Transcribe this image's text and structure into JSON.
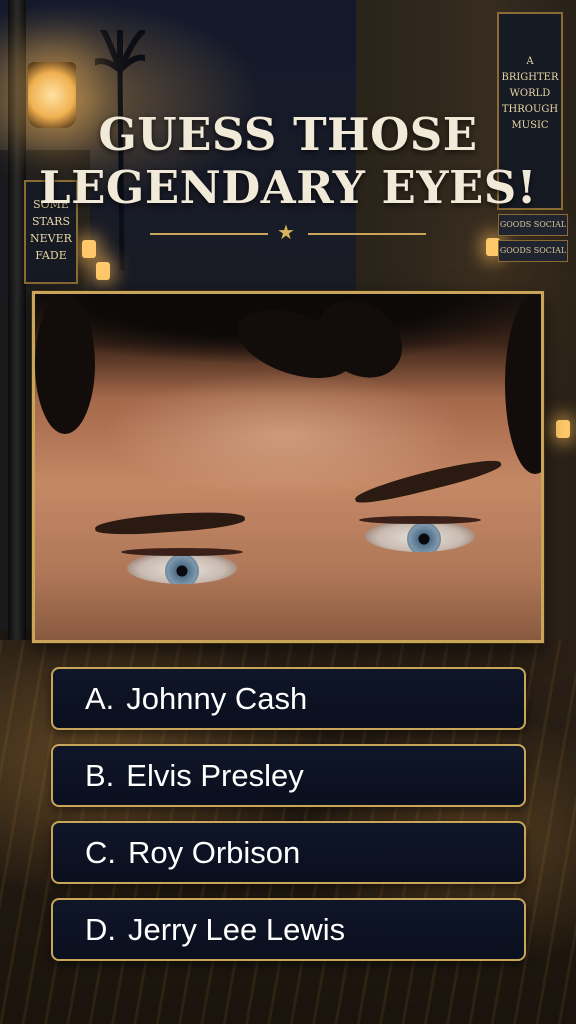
{
  "title": {
    "line1": "GUESS THOSE",
    "line2": "LEGENDARY EYES!"
  },
  "background_signs": {
    "left": [
      "SOME",
      "STARS",
      "NEVER",
      "FADE"
    ],
    "right": [
      "A",
      "BRIGHTER",
      "WORLD",
      "THROUGH",
      "MUSIC"
    ],
    "store_1": "GOODS SOCIAL",
    "store_2": "GOODS SOCIAL"
  },
  "image": {
    "alt": "eyes-closeup"
  },
  "options": [
    {
      "letter": "A.",
      "label": "Johnny Cash"
    },
    {
      "letter": "B.",
      "label": "Elvis Presley"
    },
    {
      "letter": "C.",
      "label": "Roy Orbison"
    },
    {
      "letter": "D.",
      "label": "Jerry Lee Lewis"
    }
  ],
  "colors": {
    "accent_gold": "#c9a55a",
    "button_bg": "#0f1628",
    "title_text": "#f2ead8"
  }
}
